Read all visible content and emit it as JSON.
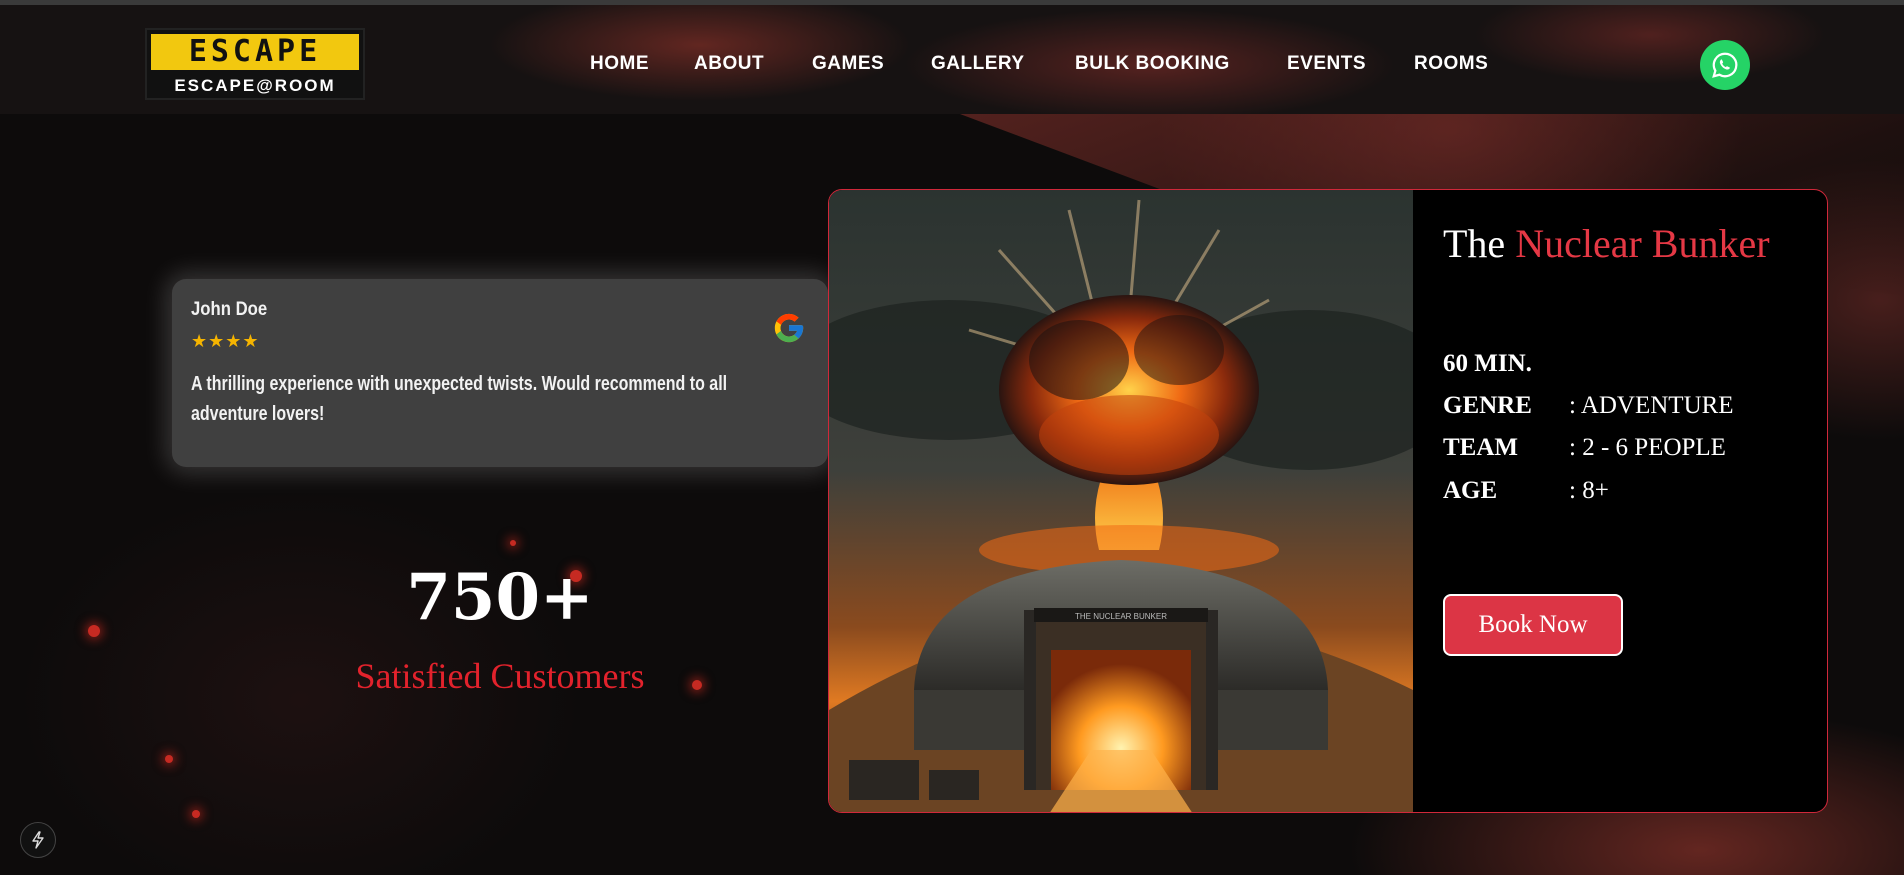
{
  "header": {
    "logo_top": "ESCAPE",
    "logo_bottom": "ESCAPE@ROOM",
    "nav": [
      "HOME",
      "ABOUT",
      "GAMES",
      "GALLERY",
      "BULK BOOKING",
      "EVENTS",
      "ROOMS"
    ]
  },
  "review": {
    "name": "John Doe",
    "stars": "★★★★",
    "text": "A thrilling experience with unexpected twists. Would recommend to all adventure lovers!"
  },
  "stats": {
    "number": "750+",
    "label": "Satisfied Customers"
  },
  "room": {
    "title_prefix": "The",
    "title_accent": "Nuclear Bunker",
    "image_sign": "THE NUCLEAR BUNKER",
    "duration": "60 MIN.",
    "specs": [
      {
        "label": "GENRE",
        "value": ": ADVENTURE"
      },
      {
        "label": "TEAM",
        "value": ": 2 - 6 PEOPLE"
      },
      {
        "label": "AGE",
        "value": ": 8+"
      }
    ],
    "book_label": "Book Now"
  },
  "colors": {
    "accent": "#e53845",
    "button": "#dc3545",
    "whatsapp": "#25d366",
    "logo_yellow": "#f2c80f"
  },
  "icons": [
    "whatsapp-icon",
    "google-icon",
    "lightning-icon"
  ]
}
